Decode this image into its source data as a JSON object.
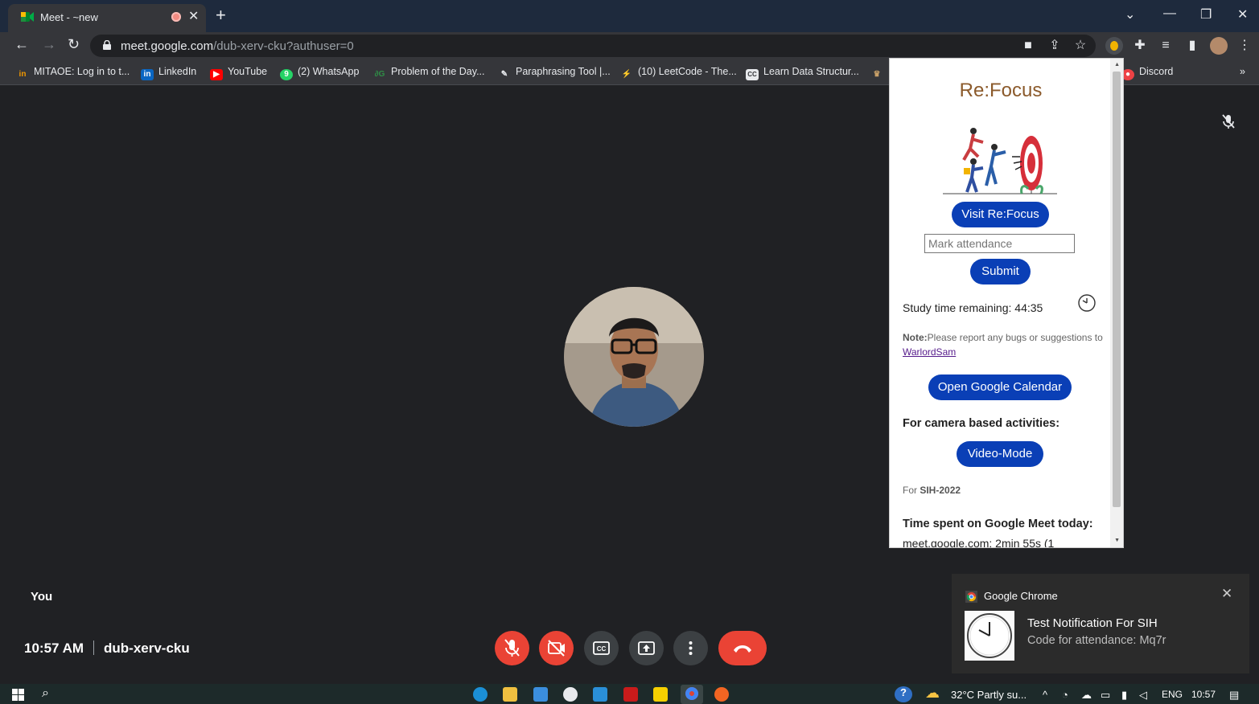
{
  "browser": {
    "tab_title": "Meet - ~new",
    "url_host": "meet.google.com",
    "url_path": "/dub-xerv-cku?authuser=0"
  },
  "bookmarks": [
    {
      "label": "MITAOE: Log in to t...",
      "icon": "mitaoe-icon",
      "color": "#f29900"
    },
    {
      "label": "LinkedIn",
      "icon": "linkedin-icon",
      "color": "#0a66c2"
    },
    {
      "label": "YouTube",
      "icon": "youtube-icon",
      "color": "#ff0000"
    },
    {
      "label": "(2) WhatsApp",
      "icon": "whatsapp-icon",
      "color": "#25d366"
    },
    {
      "label": "Problem of the Day...",
      "icon": "gfg-icon",
      "color": "#2f8d46"
    },
    {
      "label": "Paraphrasing Tool |...",
      "icon": "quill-icon",
      "color": "#e8eaed"
    },
    {
      "label": "(10) LeetCode - The...",
      "icon": "leetcode-icon",
      "color": "#e8eaed"
    },
    {
      "label": "Learn Data Structur...",
      "icon": "cc-icon",
      "color": "#e8eaed"
    },
    {
      "label": "Discord",
      "icon": "discord-icon",
      "color": "#ed4245"
    }
  ],
  "meet": {
    "self_label": "You",
    "time": "10:57 AM",
    "meeting_code": "dub-xerv-cku"
  },
  "popup": {
    "title": "Re:Focus",
    "visit_button": "Visit Re:Focus",
    "attendance_placeholder": "Mark attendance",
    "submit_button": "Submit",
    "study_time": "Study time remaining: 44:35",
    "note_label": "Note:",
    "note_text": "Please report any bugs or suggestions to ",
    "note_link": "WarlordSam",
    "calendar_button": "Open Google Calendar",
    "camera_label": "For camera based activities:",
    "video_button": "Video-Mode",
    "for_label": "For ",
    "for_event": "SIH-2022",
    "time_spent_label": "Time spent on Google Meet today:",
    "time_spent_detail": "meet.google.com: 2min 55s (1"
  },
  "notification": {
    "app": "Google Chrome",
    "title": "Test Notification For SIH",
    "body": "Code for attendance: Mq7r"
  },
  "taskbar": {
    "weather": "32°C  Partly su...",
    "language": "ENG",
    "clock": "10:57"
  },
  "colors": {
    "accent_blue": "#0a3fb6",
    "danger_red": "#ea4335",
    "meet_bg": "#202124",
    "refocus_title": "#8b5a2b"
  }
}
